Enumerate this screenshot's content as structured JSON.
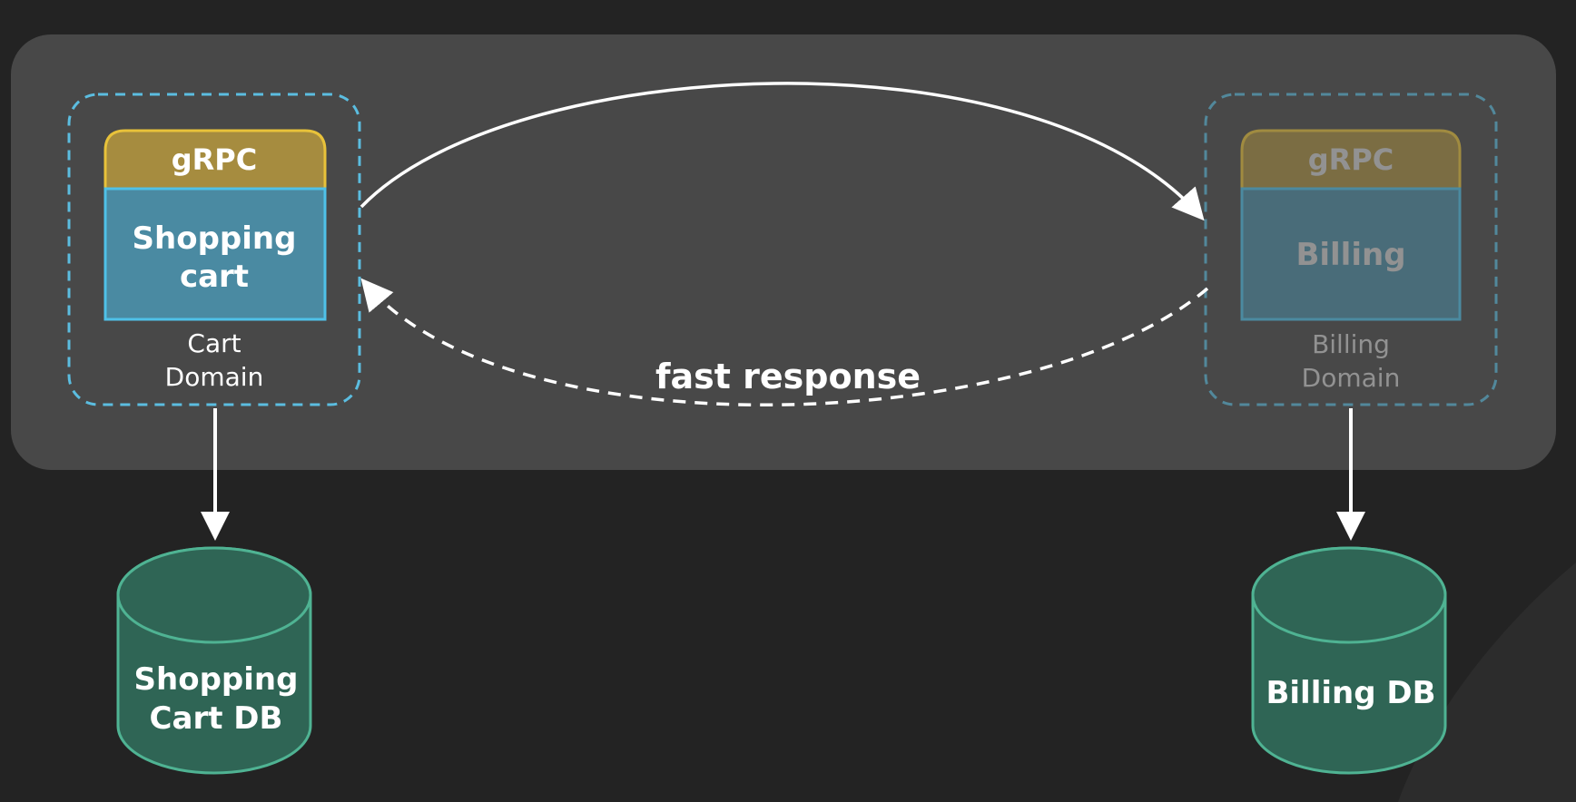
{
  "colors": {
    "background": "#232323",
    "panel": "#484848",
    "grpc_header": "#a68c3f",
    "grpc_border": "#e8c23a",
    "service_body": "#4a8aa2",
    "service_border": "#4fc1e8",
    "domain_border": "#5bbde0",
    "db_fill": "#2f6555",
    "db_border": "#4fb393",
    "arrow": "#ffffff",
    "text": "#ffffff",
    "dim_text": "#8a8a8a"
  },
  "cart": {
    "grpc_label": "gRPC",
    "service_line1": "Shopping",
    "service_line2": "cart",
    "domain_line1": "Cart",
    "domain_line2": "Domain"
  },
  "billing": {
    "grpc_label": "gRPC",
    "service_label": "Billing",
    "domain_line1": "Billing",
    "domain_line2": "Domain"
  },
  "response_label": "fast response",
  "cart_db": {
    "line1": "Shopping",
    "line2": "Cart DB"
  },
  "billing_db": {
    "label": "Billing DB"
  },
  "icons": {
    "request_arrow": "curved-arrow-right",
    "response_arrow": "dashed-curved-arrow-left",
    "db_arrow": "arrow-down"
  }
}
